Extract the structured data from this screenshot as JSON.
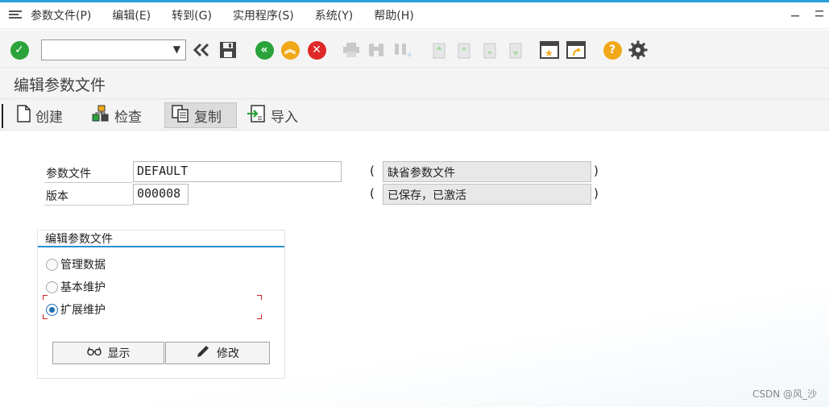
{
  "menubar": {
    "items": [
      {
        "label": "参数文件(P)"
      },
      {
        "label": "编辑(E)"
      },
      {
        "label": "转到(G)"
      },
      {
        "label": "实用程序(S)"
      },
      {
        "label": "系统(Y)"
      },
      {
        "label": "帮助(H)"
      }
    ]
  },
  "toolbar": {
    "command_field_value": ""
  },
  "title": "编辑参数文件",
  "app_toolbar": {
    "create": "创建",
    "check": "检查",
    "copy": "复制",
    "import": "导入"
  },
  "form": {
    "profile_label": "参数文件",
    "profile_value": "DEFAULT",
    "profile_desc": "缺省参数文件",
    "version_label": "版本",
    "version_value": "000008",
    "version_desc": "已保存，已激活",
    "paren_open": "(",
    "paren_close": ")"
  },
  "group": {
    "title": "编辑参数文件",
    "options": [
      {
        "label": "管理数据",
        "selected": false
      },
      {
        "label": "基本维护",
        "selected": false
      },
      {
        "label": "扩展维护",
        "selected": true
      }
    ],
    "display_button": "显示",
    "change_button": "修改"
  },
  "footer": "CSDN @风_沙",
  "colors": {
    "green": "#2aa33a",
    "orange": "#f0a818",
    "red": "#e02828",
    "blue": "#1d6fb8",
    "accent_line": "#2aa0d8"
  }
}
